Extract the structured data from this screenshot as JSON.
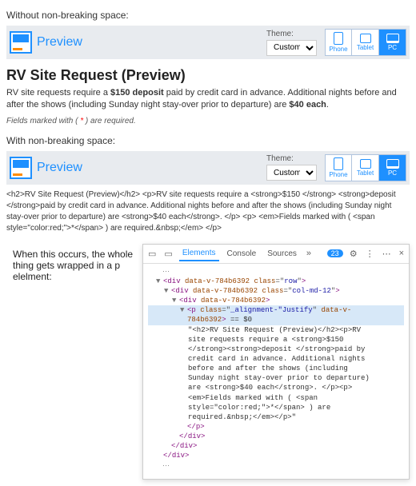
{
  "section1": {
    "label": "Without non-breaking space:"
  },
  "section2": {
    "label": "With non-breaking space:"
  },
  "previewBar": {
    "label": "Preview",
    "themeLabel": "Theme:",
    "themeValue": "Custom",
    "devices": {
      "phone": "Phone",
      "tablet": "Tablet",
      "pc": "PC"
    }
  },
  "rendered": {
    "heading": "RV Site Request (Preview)",
    "body_prefix": "RV site requests require a ",
    "deposit_amount": "$150 deposit",
    "body_mid": " paid by credit card in advance. Additional nights before and after the shows (including Sunday night stay-over prior to departure) are ",
    "night_amount": "$40 each",
    "body_suffix": ".",
    "fields_prefix": "Fields marked with ( ",
    "fields_star": "*",
    "fields_suffix": " ) are required."
  },
  "rawHtml": "<h2>RV Site Request (Preview)</h2> <p>RV site requests require a <strong>$150 </strong> <strong>deposit </strong>paid by credit card in advance. Additional nights before and after the shows (including Sunday night stay-over prior to departure) are <strong>$40 each</strong>. </p> <p> <em>Fields marked with ( <span style=\"color:red;\">*</span> ) are required.&nbsp;</em> </p>",
  "wrapNote": "When this occurs, the whole thing gets wrapped in a p elelment:",
  "devtools": {
    "tabs": {
      "elements": "Elements",
      "console": "Console",
      "sources": "Sources"
    },
    "badge": "23",
    "tree": {
      "row_open": "<div data-v-784b6392 class=\"row\">",
      "col_open": "<div data-v-784b6392 class=\"col-md-12\">",
      "innerdiv_open": "<div data-v-784b6392>",
      "p_open": "<p class=\"_alignment-\"Justify\" data-v-784b6392>",
      "collapsed_before": "== $0",
      "quoted": "\"<h2>RV Site Request (Preview)</h2><p>RV site requests require a <strong>$150 </strong><strong>deposit </strong>paid by credit card in advance. Additional nights before and after the shows (including Sunday night stay-over prior to departure) are <strong>$40 each</strong>. </p><p><em>Fields marked with ( <span style=\"color:red;\">*</span> ) are required.&nbsp;</em></p>\"",
      "p_close": "</p>",
      "div_close": "</div>"
    }
  }
}
